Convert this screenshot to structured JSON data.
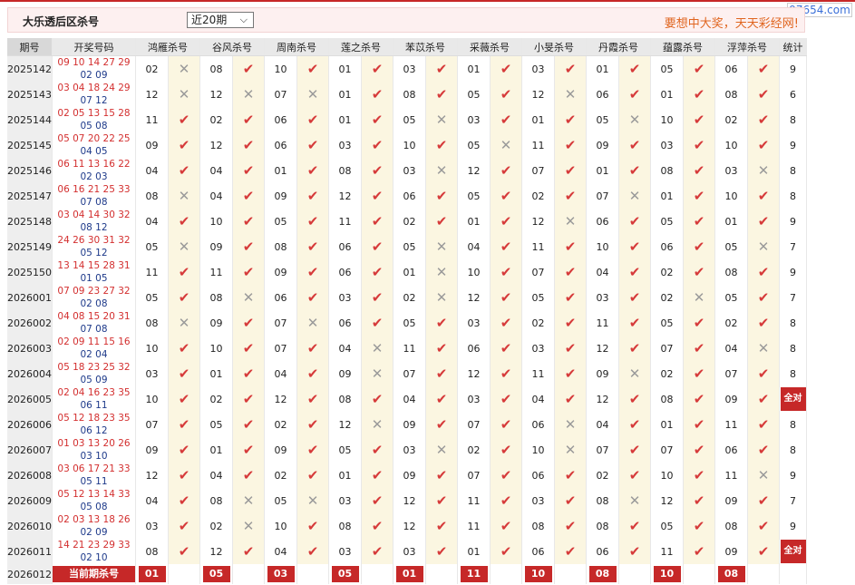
{
  "header": {
    "title": "大乐透后区杀号",
    "period_select": "近20期",
    "slogan": "要想中大奖，天天彩经网!",
    "brand": "97654.com"
  },
  "columns": [
    "期号",
    "开奖号码",
    "鸿雁杀号",
    "谷风杀号",
    "周南杀号",
    "莲之杀号",
    "苯苡杀号",
    "采薇杀号",
    "小旻杀号",
    "丹霞杀号",
    "蕴露杀号",
    "浮萍杀号",
    "统计"
  ],
  "rows": [
    {
      "issue": "2025142",
      "front": "09 10 14 27 29",
      "back": "02 09",
      "kills": [
        [
          "02",
          "n"
        ],
        [
          "08",
          "y"
        ],
        [
          "10",
          "y"
        ],
        [
          "01",
          "y"
        ],
        [
          "03",
          "y"
        ],
        [
          "01",
          "y"
        ],
        [
          "03",
          "y"
        ],
        [
          "01",
          "y"
        ],
        [
          "05",
          "y"
        ],
        [
          "06",
          "y"
        ]
      ],
      "stat": "9"
    },
    {
      "issue": "2025143",
      "front": "03 04 18 24 29",
      "back": "07 12",
      "kills": [
        [
          "12",
          "n"
        ],
        [
          "12",
          "n"
        ],
        [
          "07",
          "n"
        ],
        [
          "01",
          "y"
        ],
        [
          "08",
          "y"
        ],
        [
          "05",
          "y"
        ],
        [
          "12",
          "n"
        ],
        [
          "06",
          "y"
        ],
        [
          "01",
          "y"
        ],
        [
          "08",
          "y"
        ]
      ],
      "stat": "6"
    },
    {
      "issue": "2025144",
      "front": "02 05 13 15 28",
      "back": "05 08",
      "kills": [
        [
          "11",
          "y"
        ],
        [
          "02",
          "y"
        ],
        [
          "06",
          "y"
        ],
        [
          "01",
          "y"
        ],
        [
          "05",
          "n"
        ],
        [
          "03",
          "y"
        ],
        [
          "01",
          "y"
        ],
        [
          "05",
          "n"
        ],
        [
          "10",
          "y"
        ],
        [
          "02",
          "y"
        ]
      ],
      "stat": "8"
    },
    {
      "issue": "2025145",
      "front": "05 07 20 22 25",
      "back": "04 05",
      "kills": [
        [
          "09",
          "y"
        ],
        [
          "12",
          "y"
        ],
        [
          "06",
          "y"
        ],
        [
          "03",
          "y"
        ],
        [
          "10",
          "y"
        ],
        [
          "05",
          "n"
        ],
        [
          "11",
          "y"
        ],
        [
          "09",
          "y"
        ],
        [
          "03",
          "y"
        ],
        [
          "10",
          "y"
        ]
      ],
      "stat": "9"
    },
    {
      "issue": "2025146",
      "front": "06 11 13 16 22",
      "back": "02 03",
      "kills": [
        [
          "04",
          "y"
        ],
        [
          "04",
          "y"
        ],
        [
          "01",
          "y"
        ],
        [
          "08",
          "y"
        ],
        [
          "03",
          "n"
        ],
        [
          "12",
          "y"
        ],
        [
          "07",
          "y"
        ],
        [
          "01",
          "y"
        ],
        [
          "08",
          "y"
        ],
        [
          "03",
          "n"
        ]
      ],
      "stat": "8"
    },
    {
      "issue": "2025147",
      "front": "06 16 21 25 33",
      "back": "07 08",
      "kills": [
        [
          "08",
          "n"
        ],
        [
          "04",
          "y"
        ],
        [
          "09",
          "y"
        ],
        [
          "12",
          "y"
        ],
        [
          "06",
          "y"
        ],
        [
          "05",
          "y"
        ],
        [
          "02",
          "y"
        ],
        [
          "07",
          "n"
        ],
        [
          "01",
          "y"
        ],
        [
          "10",
          "y"
        ]
      ],
      "stat": "8"
    },
    {
      "issue": "2025148",
      "front": "03 04 14 30 32",
      "back": "08 12",
      "kills": [
        [
          "04",
          "y"
        ],
        [
          "10",
          "y"
        ],
        [
          "05",
          "y"
        ],
        [
          "11",
          "y"
        ],
        [
          "02",
          "y"
        ],
        [
          "01",
          "y"
        ],
        [
          "12",
          "n"
        ],
        [
          "06",
          "y"
        ],
        [
          "05",
          "y"
        ],
        [
          "01",
          "y"
        ]
      ],
      "stat": "9"
    },
    {
      "issue": "2025149",
      "front": "24 26 30 31 32",
      "back": "05 12",
      "kills": [
        [
          "05",
          "n"
        ],
        [
          "09",
          "y"
        ],
        [
          "08",
          "y"
        ],
        [
          "06",
          "y"
        ],
        [
          "05",
          "n"
        ],
        [
          "04",
          "y"
        ],
        [
          "11",
          "y"
        ],
        [
          "10",
          "y"
        ],
        [
          "06",
          "y"
        ],
        [
          "05",
          "n"
        ]
      ],
      "stat": "7"
    },
    {
      "issue": "2025150",
      "front": "13 14 15 28 31",
      "back": "01 05",
      "kills": [
        [
          "11",
          "y"
        ],
        [
          "11",
          "y"
        ],
        [
          "09",
          "y"
        ],
        [
          "06",
          "y"
        ],
        [
          "01",
          "n"
        ],
        [
          "10",
          "y"
        ],
        [
          "07",
          "y"
        ],
        [
          "04",
          "y"
        ],
        [
          "02",
          "y"
        ],
        [
          "08",
          "y"
        ]
      ],
      "stat": "9"
    },
    {
      "issue": "2026001",
      "front": "07 09 23 27 32",
      "back": "02 08",
      "kills": [
        [
          "05",
          "y"
        ],
        [
          "08",
          "n"
        ],
        [
          "06",
          "y"
        ],
        [
          "03",
          "y"
        ],
        [
          "02",
          "n"
        ],
        [
          "12",
          "y"
        ],
        [
          "05",
          "y"
        ],
        [
          "03",
          "y"
        ],
        [
          "02",
          "n"
        ],
        [
          "05",
          "y"
        ]
      ],
      "stat": "7"
    },
    {
      "issue": "2026002",
      "front": "04 08 15 20 31",
      "back": "07 08",
      "kills": [
        [
          "08",
          "n"
        ],
        [
          "09",
          "y"
        ],
        [
          "07",
          "n"
        ],
        [
          "06",
          "y"
        ],
        [
          "05",
          "y"
        ],
        [
          "03",
          "y"
        ],
        [
          "02",
          "y"
        ],
        [
          "11",
          "y"
        ],
        [
          "05",
          "y"
        ],
        [
          "02",
          "y"
        ]
      ],
      "stat": "8"
    },
    {
      "issue": "2026003",
      "front": "02 09 11 15 16",
      "back": "02 04",
      "kills": [
        [
          "10",
          "y"
        ],
        [
          "10",
          "y"
        ],
        [
          "07",
          "y"
        ],
        [
          "04",
          "n"
        ],
        [
          "11",
          "y"
        ],
        [
          "06",
          "y"
        ],
        [
          "03",
          "y"
        ],
        [
          "12",
          "y"
        ],
        [
          "07",
          "y"
        ],
        [
          "04",
          "n"
        ]
      ],
      "stat": "8"
    },
    {
      "issue": "2026004",
      "front": "05 18 23 25 32",
      "back": "05 09",
      "kills": [
        [
          "03",
          "y"
        ],
        [
          "01",
          "y"
        ],
        [
          "04",
          "y"
        ],
        [
          "09",
          "n"
        ],
        [
          "07",
          "y"
        ],
        [
          "12",
          "y"
        ],
        [
          "11",
          "y"
        ],
        [
          "09",
          "n"
        ],
        [
          "02",
          "y"
        ],
        [
          "07",
          "y"
        ]
      ],
      "stat": "8"
    },
    {
      "issue": "2026005",
      "front": "02 04 16 23 35",
      "back": "06 11",
      "kills": [
        [
          "10",
          "y"
        ],
        [
          "02",
          "y"
        ],
        [
          "12",
          "y"
        ],
        [
          "08",
          "y"
        ],
        [
          "04",
          "y"
        ],
        [
          "03",
          "y"
        ],
        [
          "04",
          "y"
        ],
        [
          "12",
          "y"
        ],
        [
          "08",
          "y"
        ],
        [
          "09",
          "y"
        ]
      ],
      "stat": "全对"
    },
    {
      "issue": "2026006",
      "front": "05 12 18 23 35",
      "back": "06 12",
      "kills": [
        [
          "07",
          "y"
        ],
        [
          "05",
          "y"
        ],
        [
          "02",
          "y"
        ],
        [
          "12",
          "n"
        ],
        [
          "09",
          "y"
        ],
        [
          "07",
          "y"
        ],
        [
          "06",
          "n"
        ],
        [
          "04",
          "y"
        ],
        [
          "01",
          "y"
        ],
        [
          "11",
          "y"
        ]
      ],
      "stat": "8"
    },
    {
      "issue": "2026007",
      "front": "01 03 13 20 26",
      "back": "03 10",
      "kills": [
        [
          "09",
          "y"
        ],
        [
          "01",
          "y"
        ],
        [
          "09",
          "y"
        ],
        [
          "05",
          "y"
        ],
        [
          "03",
          "n"
        ],
        [
          "02",
          "y"
        ],
        [
          "10",
          "n"
        ],
        [
          "07",
          "y"
        ],
        [
          "07",
          "y"
        ],
        [
          "06",
          "y"
        ]
      ],
      "stat": "8"
    },
    {
      "issue": "2026008",
      "front": "03 06 17 21 33",
      "back": "05 11",
      "kills": [
        [
          "12",
          "y"
        ],
        [
          "04",
          "y"
        ],
        [
          "02",
          "y"
        ],
        [
          "01",
          "y"
        ],
        [
          "09",
          "y"
        ],
        [
          "07",
          "y"
        ],
        [
          "06",
          "y"
        ],
        [
          "02",
          "y"
        ],
        [
          "10",
          "y"
        ],
        [
          "11",
          "n"
        ]
      ],
      "stat": "9"
    },
    {
      "issue": "2026009",
      "front": "05 12 13 14 33",
      "back": "05 08",
      "kills": [
        [
          "04",
          "y"
        ],
        [
          "08",
          "n"
        ],
        [
          "05",
          "n"
        ],
        [
          "03",
          "y"
        ],
        [
          "12",
          "y"
        ],
        [
          "11",
          "y"
        ],
        [
          "03",
          "y"
        ],
        [
          "08",
          "n"
        ],
        [
          "12",
          "y"
        ],
        [
          "09",
          "y"
        ]
      ],
      "stat": "7"
    },
    {
      "issue": "2026010",
      "front": "02 03 13 18 26",
      "back": "02 09",
      "kills": [
        [
          "03",
          "y"
        ],
        [
          "02",
          "n"
        ],
        [
          "10",
          "y"
        ],
        [
          "08",
          "y"
        ],
        [
          "12",
          "y"
        ],
        [
          "11",
          "y"
        ],
        [
          "08",
          "y"
        ],
        [
          "08",
          "y"
        ],
        [
          "05",
          "y"
        ],
        [
          "08",
          "y"
        ]
      ],
      "stat": "9"
    },
    {
      "issue": "2026011",
      "front": "14 21 23 29 33",
      "back": "02 10",
      "kills": [
        [
          "08",
          "y"
        ],
        [
          "12",
          "y"
        ],
        [
          "04",
          "y"
        ],
        [
          "03",
          "y"
        ],
        [
          "03",
          "y"
        ],
        [
          "01",
          "y"
        ],
        [
          "06",
          "y"
        ],
        [
          "06",
          "y"
        ],
        [
          "11",
          "y"
        ],
        [
          "09",
          "y"
        ]
      ],
      "stat": "全对"
    }
  ],
  "current": {
    "issue": "2026012",
    "label": "当前期杀号",
    "kills": [
      "01",
      "05",
      "03",
      "05",
      "01",
      "11",
      "10",
      "08",
      "10",
      "08"
    ]
  },
  "icons": {
    "hit": "check-icon",
    "miss": "cross-icon"
  },
  "colors": {
    "accent": "#c62828",
    "front_number": "#d32f2f",
    "back_number": "#1e3a8a",
    "hit": "#d63a3a",
    "miss": "#9a9a9a",
    "highlight": "#fbf6e1"
  }
}
